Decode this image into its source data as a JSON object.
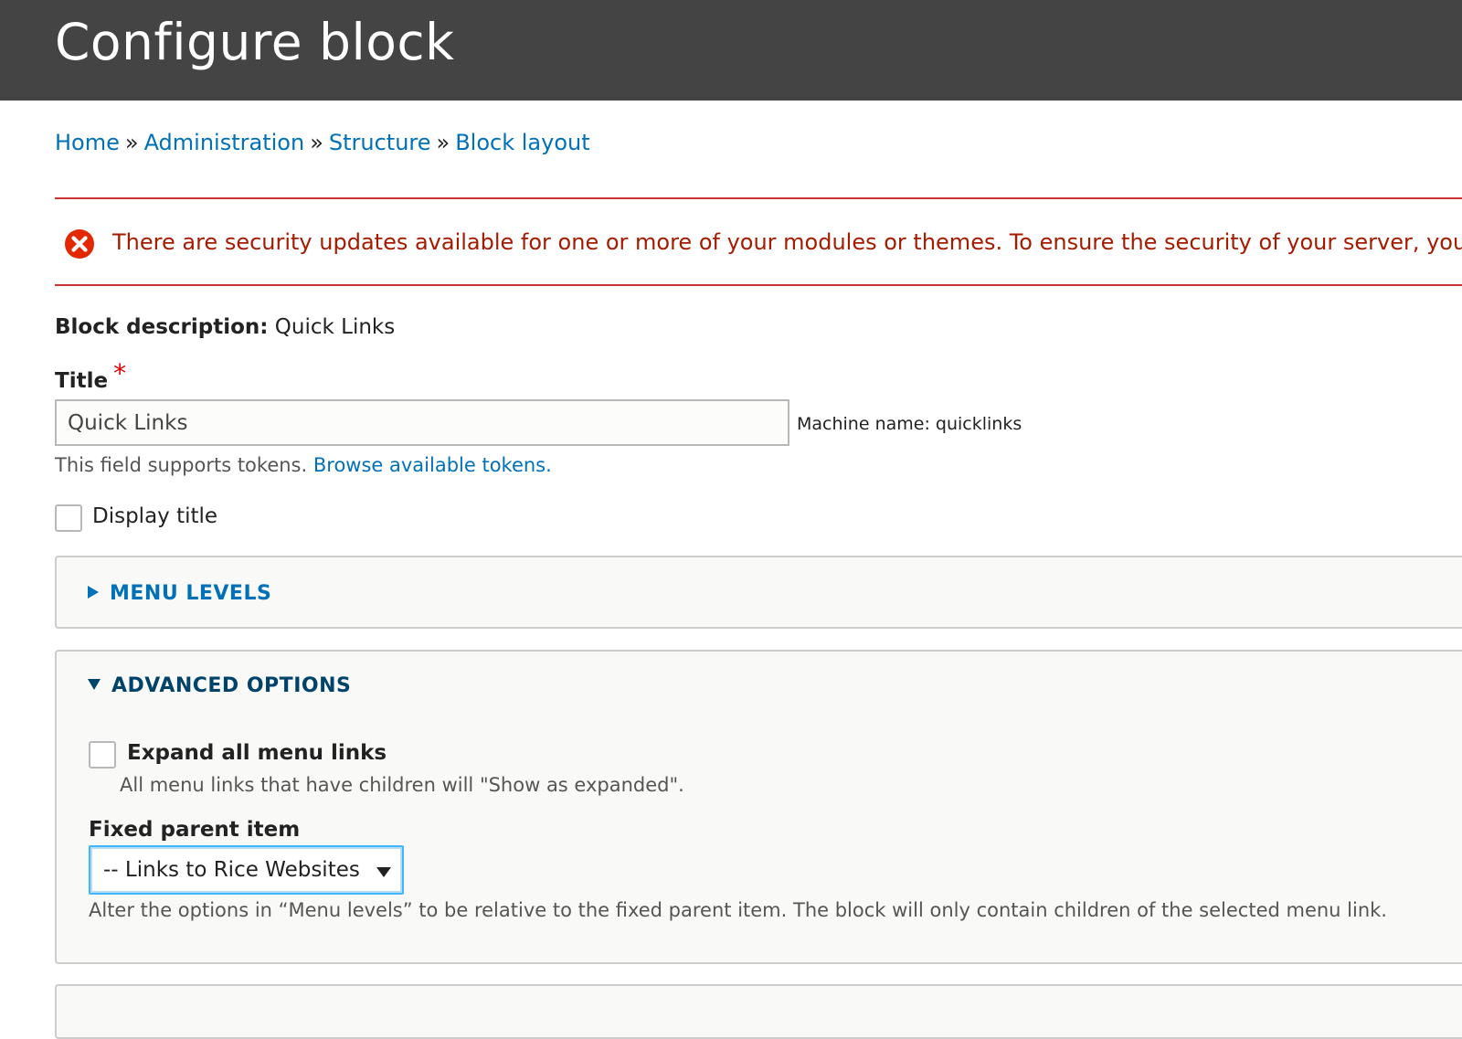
{
  "header": {
    "title": "Configure block"
  },
  "breadcrumb": {
    "items": [
      "Home",
      "Administration",
      "Structure",
      "Block layout"
    ],
    "separator": "»"
  },
  "messages": {
    "error_text": "There are security updates available for one or more of your modules or themes. To ensure the security of your server, you should",
    "error_icon": "error-circle-x-icon"
  },
  "form": {
    "block_description_label": "Block description:",
    "block_description_value": "Quick Links",
    "title_label": "Title",
    "required_mark": "*",
    "title_value": "Quick Links",
    "machine_name": "Machine name: quicklinks",
    "tokens_help": "This field supports tokens.",
    "tokens_link": "Browse available tokens.",
    "display_title_label": "Display title",
    "display_title_checked": false
  },
  "menu_levels": {
    "summary": "MENU LEVELS",
    "expanded": false
  },
  "advanced_options": {
    "summary": "ADVANCED OPTIONS",
    "expanded": true,
    "expand_all_label": "Expand all menu links",
    "expand_all_checked": false,
    "expand_all_help": "All menu links that have children will \"Show as expanded\".",
    "fixed_parent_label": "Fixed parent item",
    "fixed_parent_value": "-- Links to Rice Websites",
    "fixed_parent_help": "Alter the options in “Menu levels” to be relative to the fixed parent item. The block will only contain children of the selected menu link."
  },
  "colors": {
    "header_bg": "#444444",
    "link": "#0071b8",
    "error_text": "#a51b00",
    "error_border": "#cc3333",
    "focus_border": "#40b6ff"
  }
}
